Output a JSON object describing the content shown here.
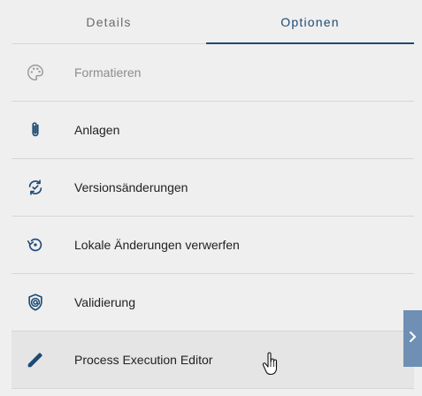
{
  "tabs": {
    "details": "Details",
    "optionen": "Optionen",
    "active": "optionen"
  },
  "menu": {
    "items": [
      {
        "label": "Formatieren",
        "icon": "palette-icon",
        "disabled": true
      },
      {
        "label": "Anlagen",
        "icon": "paperclip-icon"
      },
      {
        "label": "Versionsänderungen",
        "icon": "sync-check-icon"
      },
      {
        "label": "Lokale Änderungen verwerfen",
        "icon": "restore-icon"
      },
      {
        "label": "Validierung",
        "icon": "shield-at-icon"
      },
      {
        "label": "Process Execution Editor",
        "icon": "pencil-icon",
        "hovered": true
      }
    ]
  },
  "expand_handle": {
    "icon": "chevron-right-icon"
  },
  "colors": {
    "accent": "#1d4a74",
    "background": "#efefef",
    "disabled_text": "#8c8c8c",
    "handle": "#6f8fb4"
  }
}
